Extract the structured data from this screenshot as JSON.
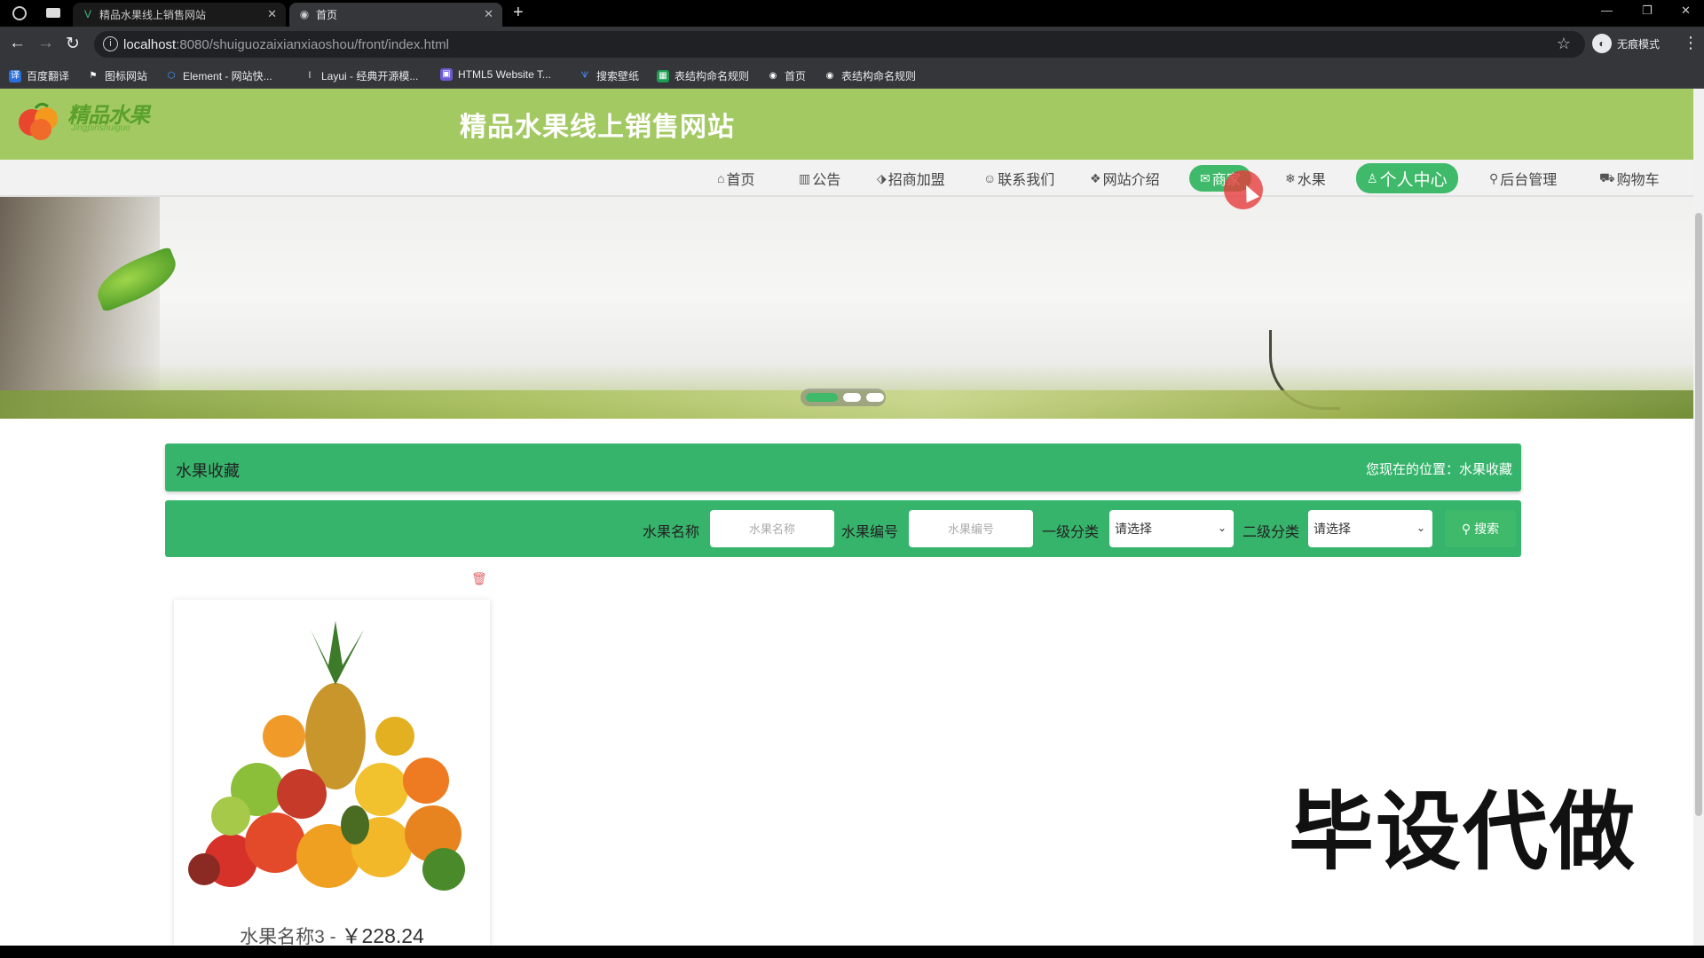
{
  "browser": {
    "tabs": [
      {
        "title": "精品水果线上销售网站"
      },
      {
        "title": "首页"
      }
    ],
    "url_host": "localhost",
    "url_rest": ":8080/shuiguozaixianxiaoshou/front/index.html",
    "incognito_label": "无痕模式",
    "bookmarks": [
      {
        "label": "百度翻译",
        "icon": "translate-icon"
      },
      {
        "label": "图标网站",
        "icon": "flag-icon"
      },
      {
        "label": "Element - 网站快...",
        "icon": "element-icon"
      },
      {
        "label": "Layui - 经典开源模...",
        "icon": "layui-icon"
      },
      {
        "label": "HTML5 Website T...",
        "icon": "html5-icon"
      },
      {
        "label": "搜索壁纸",
        "icon": "wallpaper-icon"
      },
      {
        "label": "表结构命名规则",
        "icon": "sheet-icon"
      },
      {
        "label": "首页",
        "icon": "globe-icon"
      },
      {
        "label": "表结构命名规则",
        "icon": "globe-icon"
      }
    ]
  },
  "site": {
    "logo_text": "精品水果",
    "logo_sub": "Jingpinshuiguo",
    "title": "精品水果线上销售网站",
    "nav": [
      {
        "label": "首页",
        "icon": "home-icon"
      },
      {
        "label": "公告",
        "icon": "notice-icon"
      },
      {
        "label": "招商加盟",
        "icon": "tag-icon"
      },
      {
        "label": "联系我们",
        "icon": "contact-icon"
      },
      {
        "label": "网站介绍",
        "icon": "book-icon"
      },
      {
        "label": "商家",
        "icon": "mail-icon"
      },
      {
        "label": "水果",
        "icon": "snowflake-icon"
      },
      {
        "label": "个人中心",
        "icon": "user-icon"
      },
      {
        "label": "后台管理",
        "icon": "link-icon"
      },
      {
        "label": "购物车",
        "icon": "cart-icon"
      }
    ]
  },
  "breadcrumb": {
    "title": "水果收藏",
    "position_label": "您现在的位置：",
    "position_value": "水果收藏"
  },
  "search": {
    "name_label": "水果名称",
    "name_placeholder": "水果名称",
    "code_label": "水果编号",
    "code_placeholder": "水果编号",
    "cat1_label": "一级分类",
    "cat1_value": "请选择",
    "cat2_label": "二级分类",
    "cat2_value": "请选择",
    "button_label": "搜索"
  },
  "products": [
    {
      "name": "水果名称3",
      "separator": " - ",
      "price": "￥228.24"
    }
  ],
  "watermark": "毕设代做",
  "colors": {
    "header_bg": "#a3c963",
    "accent_green": "#37b46c",
    "nav_active": "#3fba6a"
  }
}
